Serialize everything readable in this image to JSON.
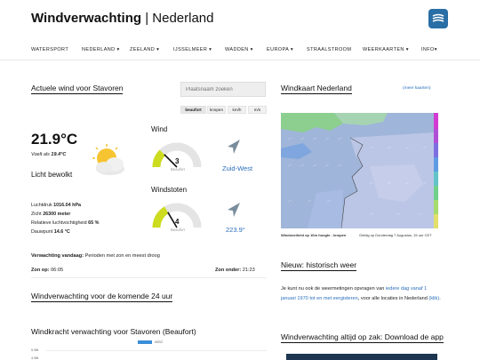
{
  "header": {
    "title_bold": "Windverwachting",
    "title_rest": " | Nederland",
    "app_icon": "wind-app-icon"
  },
  "nav": [
    {
      "label": "WATERSPORT"
    },
    {
      "label": "NEDERLAND ▾"
    },
    {
      "label": "ZEELAND ▾"
    },
    {
      "label": "IJSSELMEER ▾"
    },
    {
      "label": "WADDEN ▾"
    },
    {
      "label": "EUROPA ▾"
    },
    {
      "label": "STRAALSTROOM"
    },
    {
      "label": "WEERKAARTEN ▾"
    },
    {
      "label": "INFO▾"
    }
  ],
  "current": {
    "heading": "Actuele wind voor Stavoren",
    "search_placeholder": "Plaatsnaam zoeken",
    "units": [
      "beaufort",
      "knopen",
      "km/h",
      "m/s"
    ],
    "active_unit": "beaufort",
    "temperature": "21.9°C",
    "feels_prefix": "Voelt als ",
    "feels_value": "19.4°C",
    "condition": "Licht bewolkt",
    "weather_icon": "sun-cloud-icon",
    "wind": {
      "title": "Wind",
      "value": "3",
      "unit": "Beaufort",
      "gauge_fraction": 0.25,
      "direction_label": "Zuid-West"
    },
    "gusts": {
      "title": "Windstoten",
      "value": "4",
      "unit": "Beaufort",
      "gauge_fraction": 0.33,
      "direction_label": "223.9°"
    },
    "stats": {
      "pressure_label": "Luchtdruk ",
      "pressure_value": "1016.04 hPa",
      "visibility_label": "Zicht ",
      "visibility_value": "26300 meter",
      "humidity_label": "Relatieve luchtvochtigheid ",
      "humidity_value": "65 %",
      "dewpoint_label": "Dauwpunt ",
      "dewpoint_value": "14.6 °C"
    },
    "forecast_label": "Verwachting vandaag:",
    "forecast_text": " Perioden met zon en meest droog",
    "sunrise_label": "Zon op:",
    "sunrise_value": " 06:05",
    "sunset_label": "Zon onder:",
    "sunset_value": " 21:23"
  },
  "forecast24": {
    "heading": "Windverwachting voor de komende 24 uur"
  },
  "chart": {
    "heading": "Windkracht verwachting voor Stavoren (Beaufort)",
    "legend": "wind",
    "tick_top": "5 Bft",
    "tick_second": "4 Bft",
    "series_color": "#3b8dd8"
  },
  "windmap": {
    "heading": "Windkaart Nederland",
    "more_link": "(meer kaarten)",
    "caption_left": "Windsnelheid op 10m hoogte - knopen",
    "caption_right": "Geldig op Donderdag 7 Augustus, 15 uur CET"
  },
  "history": {
    "heading": "Nieuw: historisch weer",
    "text_1": "Je kunt nu ook de weermetingen opvragen van ",
    "link_1": "iedere dag vanaf 1 januari 1970 tot en met eergisteren",
    "text_2": ", voor alle locaties in Nederland ",
    "link_2": "(klik)",
    "text_3": "."
  },
  "app": {
    "heading": "Windverwachting altijd op zak: Download de app"
  },
  "colors": {
    "link": "#2a6ebc",
    "accent": "#3b8dd8",
    "gauge_fill": "#cddc1e"
  }
}
